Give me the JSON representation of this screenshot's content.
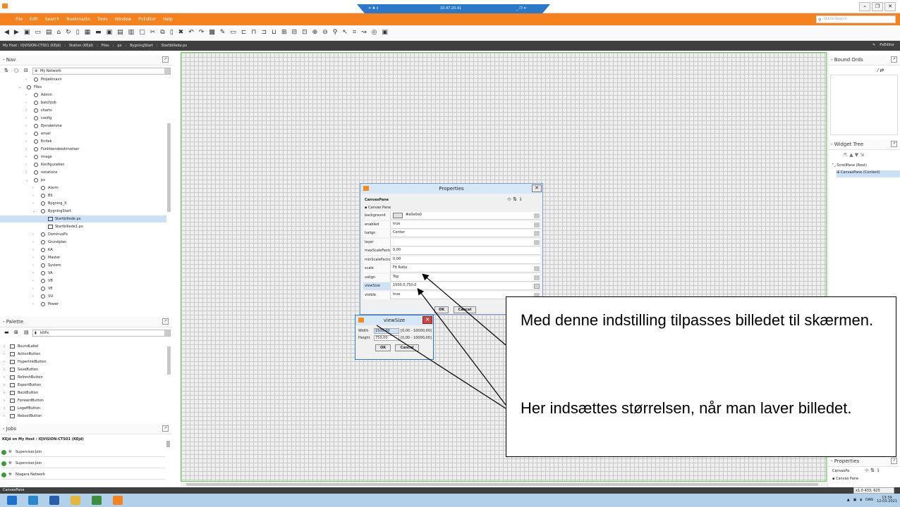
{
  "remote_bar": {
    "time": "10.47.20.41"
  },
  "menubar": {
    "items": [
      "File",
      "Edit",
      "Search",
      "Bookmarks",
      "Tools",
      "Window",
      "PxEditor",
      "Help"
    ],
    "quick_search_placeholder": "Quick Search"
  },
  "breadcrumb": {
    "items": [
      "My Host : IQVISION-CTS01 (KEjd)",
      ":",
      "Station (KEjd)",
      ":",
      "Files",
      ":",
      "px",
      ":",
      "BygningStart",
      ":",
      "Startbillede.px"
    ],
    "pxeditor": "PxEditor"
  },
  "nav": {
    "title": "Nav",
    "network": "My Network",
    "tree": [
      {
        "label": "Projektnavn",
        "level": 1,
        "expanded": false
      },
      {
        "label": "Files",
        "level": 0,
        "expanded": true
      },
      {
        "label": "Admin",
        "level": 1,
        "expanded": false
      },
      {
        "label": "batchJob",
        "level": 1,
        "expanded": false
      },
      {
        "label": "charts",
        "level": 1,
        "expanded": false
      },
      {
        "label": "config",
        "level": 1,
        "expanded": false
      },
      {
        "label": "Ejendomme",
        "level": 1,
        "expanded": false
      },
      {
        "label": "email",
        "level": 1,
        "expanded": false
      },
      {
        "label": "Enitek",
        "level": 1,
        "expanded": false
      },
      {
        "label": "Funktionsbeskrivelser",
        "level": 1,
        "expanded": false
      },
      {
        "label": "image",
        "level": 1,
        "expanded": false
      },
      {
        "label": "Konfiguration",
        "level": 1,
        "expanded": false
      },
      {
        "label": "notations",
        "level": 1,
        "expanded": false
      },
      {
        "label": "px",
        "level": 1,
        "expanded": true
      },
      {
        "label": "Alarm",
        "level": 2,
        "expanded": false
      },
      {
        "label": "BS",
        "level": 2,
        "expanded": false
      },
      {
        "label": "Bygning_X",
        "level": 2,
        "expanded": false
      },
      {
        "label": "BygningStart",
        "level": 2,
        "expanded": true
      },
      {
        "label": "Startbillede.px",
        "level": 3,
        "file": true,
        "selected": true
      },
      {
        "label": "Startbillede1.px",
        "level": 3,
        "file": true
      },
      {
        "label": "DominusPx",
        "level": 2,
        "expanded": false
      },
      {
        "label": "Grundplan",
        "level": 2,
        "expanded": false
      },
      {
        "label": "KA",
        "level": 2,
        "expanded": false
      },
      {
        "label": "Master",
        "level": 2,
        "expanded": false
      },
      {
        "label": "System",
        "level": 2,
        "expanded": false
      },
      {
        "label": "VA",
        "level": 2,
        "expanded": false
      },
      {
        "label": "VB",
        "level": 2,
        "expanded": false
      },
      {
        "label": "VE",
        "level": 2,
        "expanded": false
      },
      {
        "label": "VU",
        "level": 2,
        "expanded": false
      },
      {
        "label": "Power",
        "level": 2,
        "expanded": false
      }
    ]
  },
  "palette": {
    "title": "Palette",
    "module": "kitPx",
    "items": [
      "BoundLabel",
      "ActionButton",
      "HyperlinkButton",
      "SaveButton",
      "RefreshButton",
      "ExportButton",
      "BackButton",
      "ForwardButton",
      "LogoffButton",
      "RebootButton"
    ]
  },
  "jobs": {
    "title": "Jobs",
    "host": "KEjd on My Host : IQVISION-CTS01 (KEjd)",
    "items": [
      "Supervisor.Join",
      "Supervisor.Join",
      "Niagara Network"
    ]
  },
  "right_panel": {
    "bound_ords": "Bound Ords",
    "widget_tree": "Widget Tree",
    "widgets": [
      "ScrollPane (Root)",
      "CanvasPane (Content)"
    ],
    "properties": "Properties",
    "props_type": "CanvasPa",
    "props_sub": "Canvas Pane"
  },
  "properties_dialog": {
    "title": "Properties",
    "type": "CanvasPane",
    "subtitle": "Canvas Pane",
    "rows": [
      {
        "name": "background",
        "value": "#e0e0e0",
        "swatch": true,
        "dropdown": true
      },
      {
        "name": "enabled",
        "value": "true",
        "dropdown": true
      },
      {
        "name": "halign",
        "value": "Center",
        "dropdown": true
      },
      {
        "name": "layer",
        "value": "",
        "dropdown": true
      },
      {
        "name": "maxScaleFactor",
        "value": "0,00"
      },
      {
        "name": "minScaleFactor",
        "value": "0,00"
      },
      {
        "name": "scale",
        "value": "Fit Ratio",
        "dropdown": true
      },
      {
        "name": "valign",
        "value": "Top",
        "dropdown": true
      },
      {
        "name": "viewSize",
        "value": "1500,0,750,0",
        "ellipsis": true,
        "highlight": true
      },
      {
        "name": "visible",
        "value": "true",
        "dropdown": true
      }
    ],
    "ok": "OK",
    "cancel": "Cancel"
  },
  "viewsize_dialog": {
    "title": "viewSize",
    "width_label": "Width",
    "width_value": "1500,00",
    "width_range": "[0,00 - 10000,00]",
    "height_label": "Height",
    "height_value": "750,00",
    "height_range": "[0,00 - 10000,00]",
    "ok": "OK",
    "cancel": "Cancel"
  },
  "callout": {
    "line1": "Med denne indstilling tilpasses billedet til skærmen.",
    "line2": "Her indsættes størrelsen, når man laver billedet."
  },
  "status": {
    "label": "CanvasPane",
    "zoom": "x1.0",
    "coords": "433, 625"
  },
  "taskbar": {
    "lang": "DAN",
    "time": "13:39",
    "date": "12-03-2021"
  },
  "colors": {
    "accent": "#f5821f",
    "selection": "#cce0f7",
    "canvas_border": "#69c95b",
    "taskbar": "#b3d0ea"
  }
}
